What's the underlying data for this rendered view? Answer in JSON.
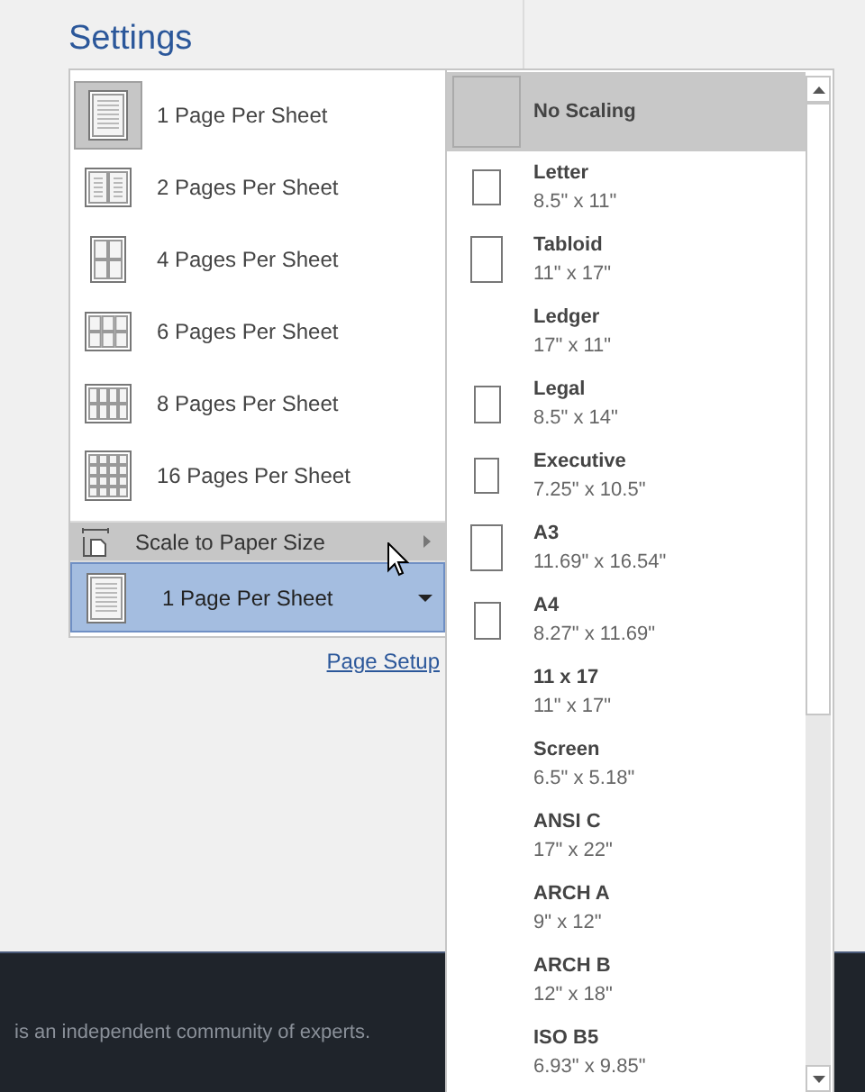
{
  "settings_title": "Settings",
  "layout_menu": [
    {
      "label": "1 Page Per Sheet",
      "kind": "one",
      "selected": true
    },
    {
      "label": "2 Pages Per Sheet",
      "kind": "two",
      "selected": false
    },
    {
      "label": "4 Pages Per Sheet",
      "kind": "four",
      "selected": false
    },
    {
      "label": "6 Pages Per Sheet",
      "kind": "six",
      "selected": false
    },
    {
      "label": "8 Pages Per Sheet",
      "kind": "eight",
      "selected": false
    },
    {
      "label": "16 Pages Per Sheet",
      "kind": "sixteen",
      "selected": false
    }
  ],
  "scale_item": {
    "label": "Scale to Paper Size",
    "hovered": true
  },
  "combo": {
    "value": "1 Page Per Sheet"
  },
  "page_setup_link": "Page Setup",
  "paper_sizes": [
    {
      "name": "No Scaling",
      "kind": "blank",
      "selected": true
    },
    {
      "name": "Letter",
      "size": "8.5\" x 11\"",
      "kind": "small",
      "selected": false
    },
    {
      "name": "Tabloid",
      "size": "11\" x 17\"",
      "kind": "tall",
      "selected": false
    },
    {
      "name": "Ledger",
      "size": "17\" x 11\"",
      "kind": "plain",
      "selected": false
    },
    {
      "name": "Legal",
      "size": "8.5\" x 14\"",
      "kind": "medium",
      "selected": false
    },
    {
      "name": "Executive",
      "size": "7.25\" x 10.5\"",
      "kind": "narrow",
      "selected": false
    },
    {
      "name": "A3",
      "size": "11.69\" x 16.54\"",
      "kind": "tall",
      "selected": false
    },
    {
      "name": "A4",
      "size": "8.27\" x 11.69\"",
      "kind": "medium",
      "selected": false
    },
    {
      "name": "11 x 17",
      "size": "11\" x 17\"",
      "kind": "plain",
      "selected": false
    },
    {
      "name": "Screen",
      "size": "6.5\" x 5.18\"",
      "kind": "plain",
      "selected": false
    },
    {
      "name": "ANSI C",
      "size": "17\" x 22\"",
      "kind": "plain",
      "selected": false
    },
    {
      "name": "ARCH A",
      "size": "9\" x 12\"",
      "kind": "plain",
      "selected": false
    },
    {
      "name": "ARCH B",
      "size": "12\" x 18\"",
      "kind": "plain",
      "selected": false
    },
    {
      "name": "ISO B5",
      "size": "6.93\" x 9.85\"",
      "kind": "plain",
      "selected": false
    }
  ],
  "footer_text": "is an independent community of experts."
}
